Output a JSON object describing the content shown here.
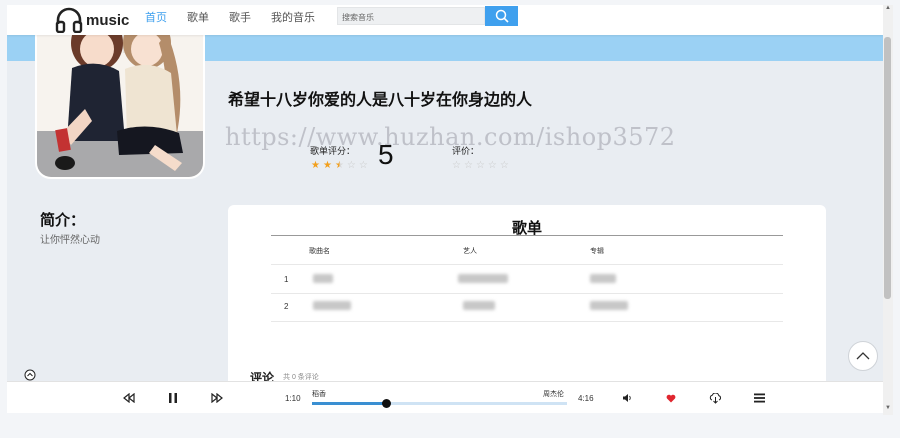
{
  "nav": {
    "logo_text": "music",
    "links": [
      "首页",
      "歌单",
      "歌手",
      "我的音乐"
    ],
    "search_placeholder": "搜索音乐"
  },
  "playlist": {
    "title": "希望十八岁你爱的人是八十岁在你身边的人",
    "watermark": "https://www.huzhan.com/ishop3572",
    "rating_label": "歌单评分：",
    "rating_value": "5",
    "rating_stars": 2.5,
    "eval_label": "评价：",
    "eval_stars": 0
  },
  "intro": {
    "title": "简介：",
    "text": "让你怦然心动"
  },
  "songs_card": {
    "title": "歌单",
    "headers": [
      "歌曲名",
      "艺人",
      "专辑"
    ],
    "rows": [
      {
        "index": "1"
      },
      {
        "index": "2"
      }
    ]
  },
  "comments": {
    "title": "评论",
    "count": "共 0 条评论"
  },
  "player": {
    "current_time": "1:10",
    "total_time": "4:16",
    "song_name": "稻香",
    "artist": "周杰伦",
    "progress": 0.29
  },
  "colors": {
    "accent": "#3fa0ee",
    "band": "#9bd1f4",
    "heart": "#e0262f",
    "star": "#f2a01e"
  }
}
